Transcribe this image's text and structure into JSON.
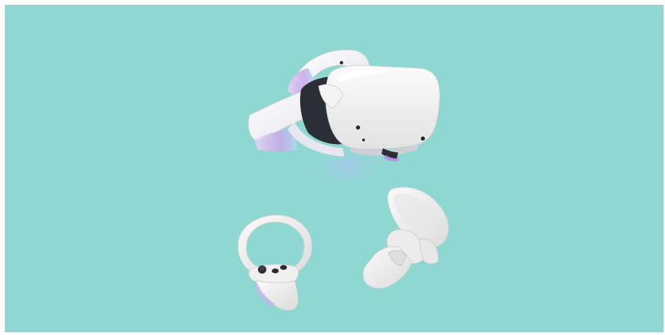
{
  "photo": {
    "background_color": "#8fd8d2",
    "device_color": "#f1f1f1",
    "accent_color": "#c9a8e8",
    "subjects": [
      "vr-headset",
      "left-controller",
      "right-controller"
    ]
  }
}
